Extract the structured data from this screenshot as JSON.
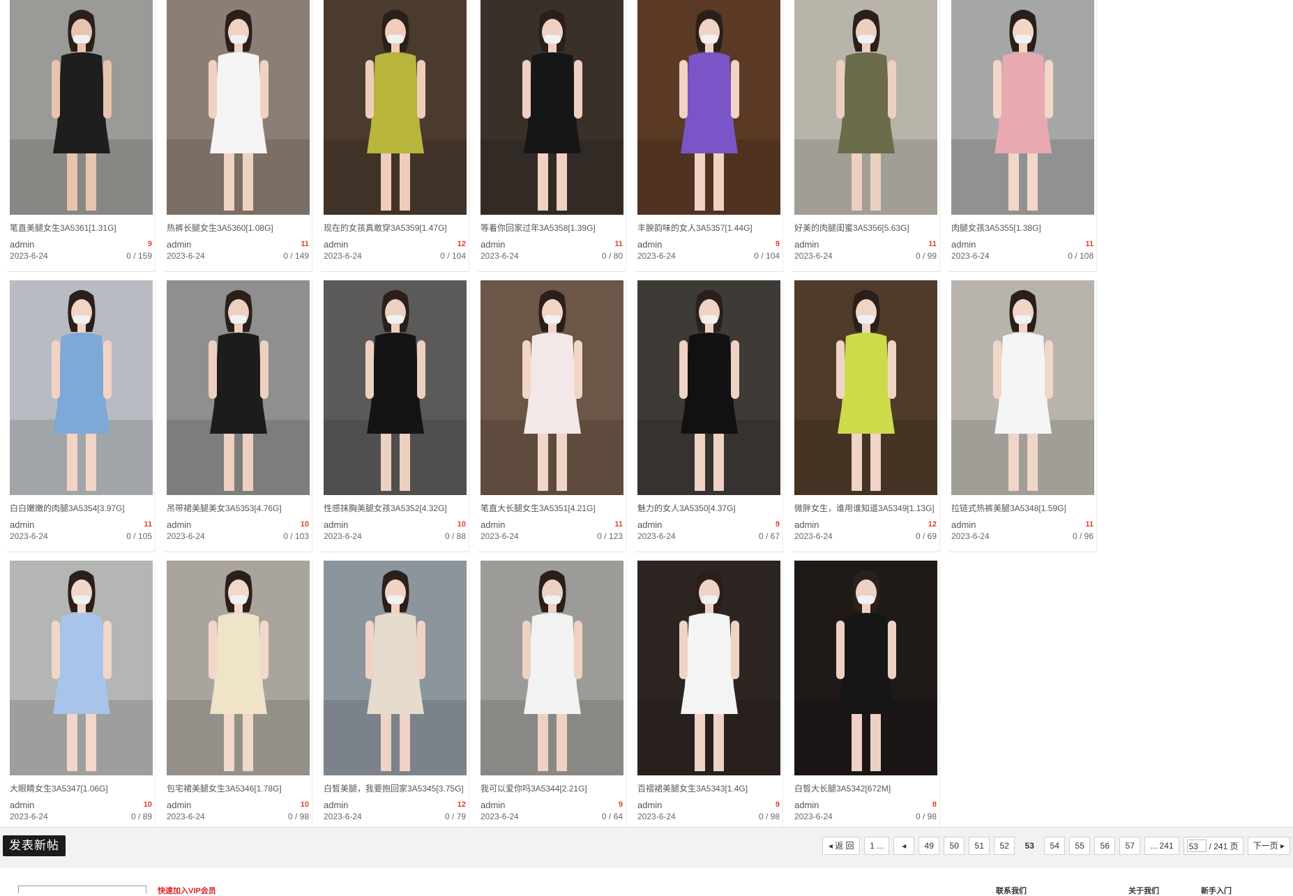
{
  "posts": [
    {
      "title": "笔直美腿女生3A5361[1.31G]",
      "author": "admin",
      "count": "9",
      "date": "2023-6-24",
      "stats": "0 / 159"
    },
    {
      "title": "热裤长腿女生3A5360[1.08G]",
      "author": "admin",
      "count": "11",
      "date": "2023-6-24",
      "stats": "0 / 149"
    },
    {
      "title": "现在的女孩真敢穿3A5359[1.47G]",
      "author": "admin",
      "count": "12",
      "date": "2023-6-24",
      "stats": "0 / 104"
    },
    {
      "title": "等着你回家过年3A5358[1.39G]",
      "author": "admin",
      "count": "11",
      "date": "2023-6-24",
      "stats": "0 / 80"
    },
    {
      "title": "丰腴韵味的女人3A5357[1.44G]",
      "author": "admin",
      "count": "9",
      "date": "2023-6-24",
      "stats": "0 / 104"
    },
    {
      "title": "好美的肉腿闺蜜3A5356[5.63G]",
      "author": "admin",
      "count": "11",
      "date": "2023-6-24",
      "stats": "0 / 99"
    },
    {
      "title": "肉腿女孩3A5355[1.38G]",
      "author": "admin",
      "count": "11",
      "date": "2023-6-24",
      "stats": "0 / 108"
    },
    {
      "title": "白白嫩嫩的肉腿3A5354[3.97G]",
      "author": "admin",
      "count": "11",
      "date": "2023-6-24",
      "stats": "0 / 105"
    },
    {
      "title": "吊带裙美腿美女3A5353[4.76G]",
      "author": "admin",
      "count": "10",
      "date": "2023-6-24",
      "stats": "0 / 103"
    },
    {
      "title": "性感抹胸美腿女孩3A5352[4.32G]",
      "author": "admin",
      "count": "10",
      "date": "2023-6-24",
      "stats": "0 / 88"
    },
    {
      "title": "笔直大长腿女生3A5351[4.21G]",
      "author": "admin",
      "count": "11",
      "date": "2023-6-24",
      "stats": "0 / 123"
    },
    {
      "title": "魅力的女人3A5350[4.37G]",
      "author": "admin",
      "count": "9",
      "date": "2023-6-24",
      "stats": "0 / 67"
    },
    {
      "title": "微胖女生，谁用谁知道3A5349[1.13G]",
      "author": "admin",
      "count": "12",
      "date": "2023-6-24",
      "stats": "0 / 69"
    },
    {
      "title": "拉链式热裤美腿3A5348[1.59G]",
      "author": "admin",
      "count": "11",
      "date": "2023-6-24",
      "stats": "0 / 96"
    },
    {
      "title": "大眼睛女生3A5347[1.06G]",
      "author": "admin",
      "count": "10",
      "date": "2023-6-24",
      "stats": "0 / 89"
    },
    {
      "title": "包宅裙美腿女生3A5346[1.78G]",
      "author": "admin",
      "count": "10",
      "date": "2023-6-24",
      "stats": "0 / 98"
    },
    {
      "title": "白皙美腿，我要抱回家3A5345[3.75G]",
      "author": "admin",
      "count": "12",
      "date": "2023-6-24",
      "stats": "0 / 79"
    },
    {
      "title": "我可以爱你吗3A5344[2.21G]",
      "author": "admin",
      "count": "9",
      "date": "2023-6-24",
      "stats": "0 / 64"
    },
    {
      "title": "百褶裙美腿女生3A5343[1.4G]",
      "author": "admin",
      "count": "9",
      "date": "2023-6-24",
      "stats": "0 / 98"
    },
    {
      "title": "白皙大长腿3A5342[672M]",
      "author": "admin",
      "count": "8",
      "date": "2023-6-24",
      "stats": "0 / 98"
    }
  ],
  "thumb_palette": [
    {
      "bg": "#9a9a96",
      "fig": "#1e1e1e",
      "skin": "#e8c4b0"
    },
    {
      "bg": "#8c7e74",
      "fig": "#f4f4f4",
      "skin": "#efd2c2"
    },
    {
      "bg": "#4a3b2e",
      "fig": "#b7b53c",
      "skin": "#f0cdbb"
    },
    {
      "bg": "#3a302a",
      "fig": "#161616",
      "skin": "#f0d0c0"
    },
    {
      "bg": "#5a3a24",
      "fig": "#7a55c7",
      "skin": "#f1d3c5"
    },
    {
      "bg": "#b9b4aa",
      "fig": "#6a6c4c",
      "skin": "#ecd0bf"
    },
    {
      "bg": "#a4a7a6",
      "fig": "#e9a9b0",
      "skin": "#f2d6c8"
    },
    {
      "bg": "#b8bcc2",
      "fig": "#7ea8d6",
      "skin": "#f1d4c5"
    },
    {
      "bg": "#8f8f8d",
      "fig": "#1c1c1c",
      "skin": "#edd0c0"
    },
    {
      "bg": "#5c5a58",
      "fig": "#141414",
      "skin": "#ecd0c0"
    },
    {
      "bg": "#6b5647",
      "fig": "#f3e8e8",
      "skin": "#f1d6c7"
    },
    {
      "bg": "#3e3a36",
      "fig": "#111111",
      "skin": "#eed2c3"
    },
    {
      "bg": "#4f3b2a",
      "fig": "#cddb4a",
      "skin": "#f0d4c6"
    },
    {
      "bg": "#b8b4ad",
      "fig": "#f5f5f5",
      "skin": "#f0d6c8"
    },
    {
      "bg": "#b3b6b2",
      "fig": "#a9c4ea",
      "skin": "#f1d7c9"
    },
    {
      "bg": "#a9a49c",
      "fig": "#efe3c8",
      "skin": "#f2d8ca"
    },
    {
      "bg": "#8c949c",
      "fig": "#e5dccd",
      "skin": "#f0d3c4"
    },
    {
      "bg": "#9d9b98",
      "fig": "#f2f2f2",
      "skin": "#eed1c2"
    },
    {
      "bg": "#2d2521",
      "fig": "#f4f4f4",
      "skin": "#efd3c4"
    },
    {
      "bg": "#1f1a18",
      "fig": "#161616",
      "skin": "#edd1c2"
    }
  ],
  "action_bar": {
    "new_post": "发表新帖"
  },
  "pager": {
    "back": "返 回",
    "first": "1 ...",
    "pages": [
      "49",
      "50",
      "51",
      "52",
      "53",
      "54",
      "55",
      "56",
      "57"
    ],
    "current": "53",
    "last": "... 241",
    "jump_value": "53",
    "total": "/ 241 页",
    "next": "下一页"
  },
  "footer": {
    "link": "快速加入VIP会员",
    "col1": "联系我们",
    "col2": "关于我们",
    "col3": "新手入门"
  }
}
